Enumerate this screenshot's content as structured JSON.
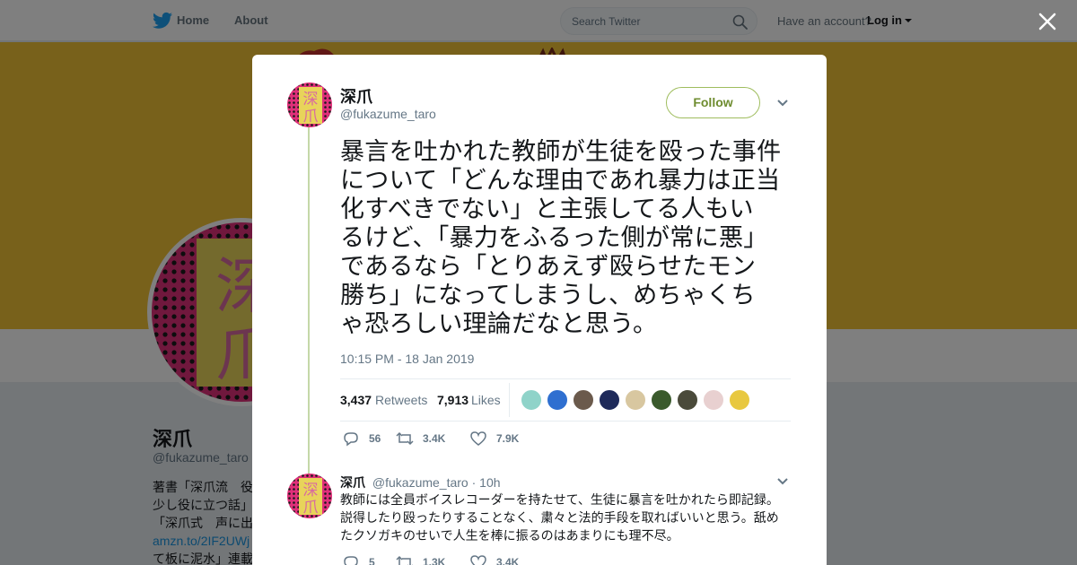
{
  "nav": {
    "home_label": "Home",
    "about_label": "About",
    "search_placeholder": "Search Twitter",
    "have_account": "Have an account?",
    "login_label": "Log in"
  },
  "profile": {
    "name": "深爪",
    "handle": "@fukazume_taro",
    "avatar_text_top": "深",
    "avatar_text_bottom": "爪",
    "bio_lines": [
      "著書「深爪流　役",
      "少し役に立つ話」",
      "「深爪式　声に出",
      "amzn.to/2IF2UWj",
      "て板に泥水」連載"
    ]
  },
  "tweet": {
    "author_name": "深爪",
    "author_handle": "@fukazume_taro",
    "follow_label": "Follow",
    "text_lines": [
      "暴言を吐かれた教師が生徒を殴った事件",
      "について「どんな理由であれ暴力は正当",
      "化すべきでない」と主張してる人もい",
      "るけど、「暴力をふるった側が常に悪」",
      "であるなら「とりあえず殴らせたモン",
      "勝ち」になってしまうし、めちゃくち",
      "ゃ恐ろしい理論だなと思う。"
    ],
    "timestamp": "10:15 PM - 18 Jan 2019",
    "retweets_count": "3,437",
    "retweets_label": "Retweets",
    "likes_count": "7,913",
    "likes_label": "Likes",
    "reply_count": "56",
    "retweet_count_short": "3.4K",
    "like_count_short": "7.9K"
  },
  "liker_avatar_colors": [
    "#8fd3c9",
    "#2f6fd0",
    "#6b5a4c",
    "#1e2a5a",
    "#d8c7a0",
    "#3a5a2c",
    "#4a4a3a",
    "#e8d0d0",
    "#e8c840"
  ],
  "reply": {
    "author_name": "深爪",
    "author_handle": "@fukazume_taro",
    "time": "· 10h",
    "text_lines": [
      "教師には全員ボイスレコーダーを持たせて、生徒に暴言を吐かれたら即記録。",
      "説得したり殴ったりすることなく、粛々と法的手段を取ればいいと思う。舐め",
      "たクソガキのせいで人生を棒に振るのはあまりにも理不尽。"
    ],
    "reply_count": "5",
    "retweet_count": "1.3K",
    "like_count": "3.4K"
  },
  "colors": {
    "banner": "#f0c237",
    "follow_accent": "#9fbd5e",
    "thread_line": "#c5d8a8",
    "avatar_pink": "#e0307a"
  },
  "icons": {
    "logo": "twitter-bird-icon",
    "search": "search-icon",
    "close": "close-icon",
    "more": "chevron-down-icon",
    "reply": "reply-icon",
    "retweet": "retweet-icon",
    "like": "heart-icon"
  }
}
